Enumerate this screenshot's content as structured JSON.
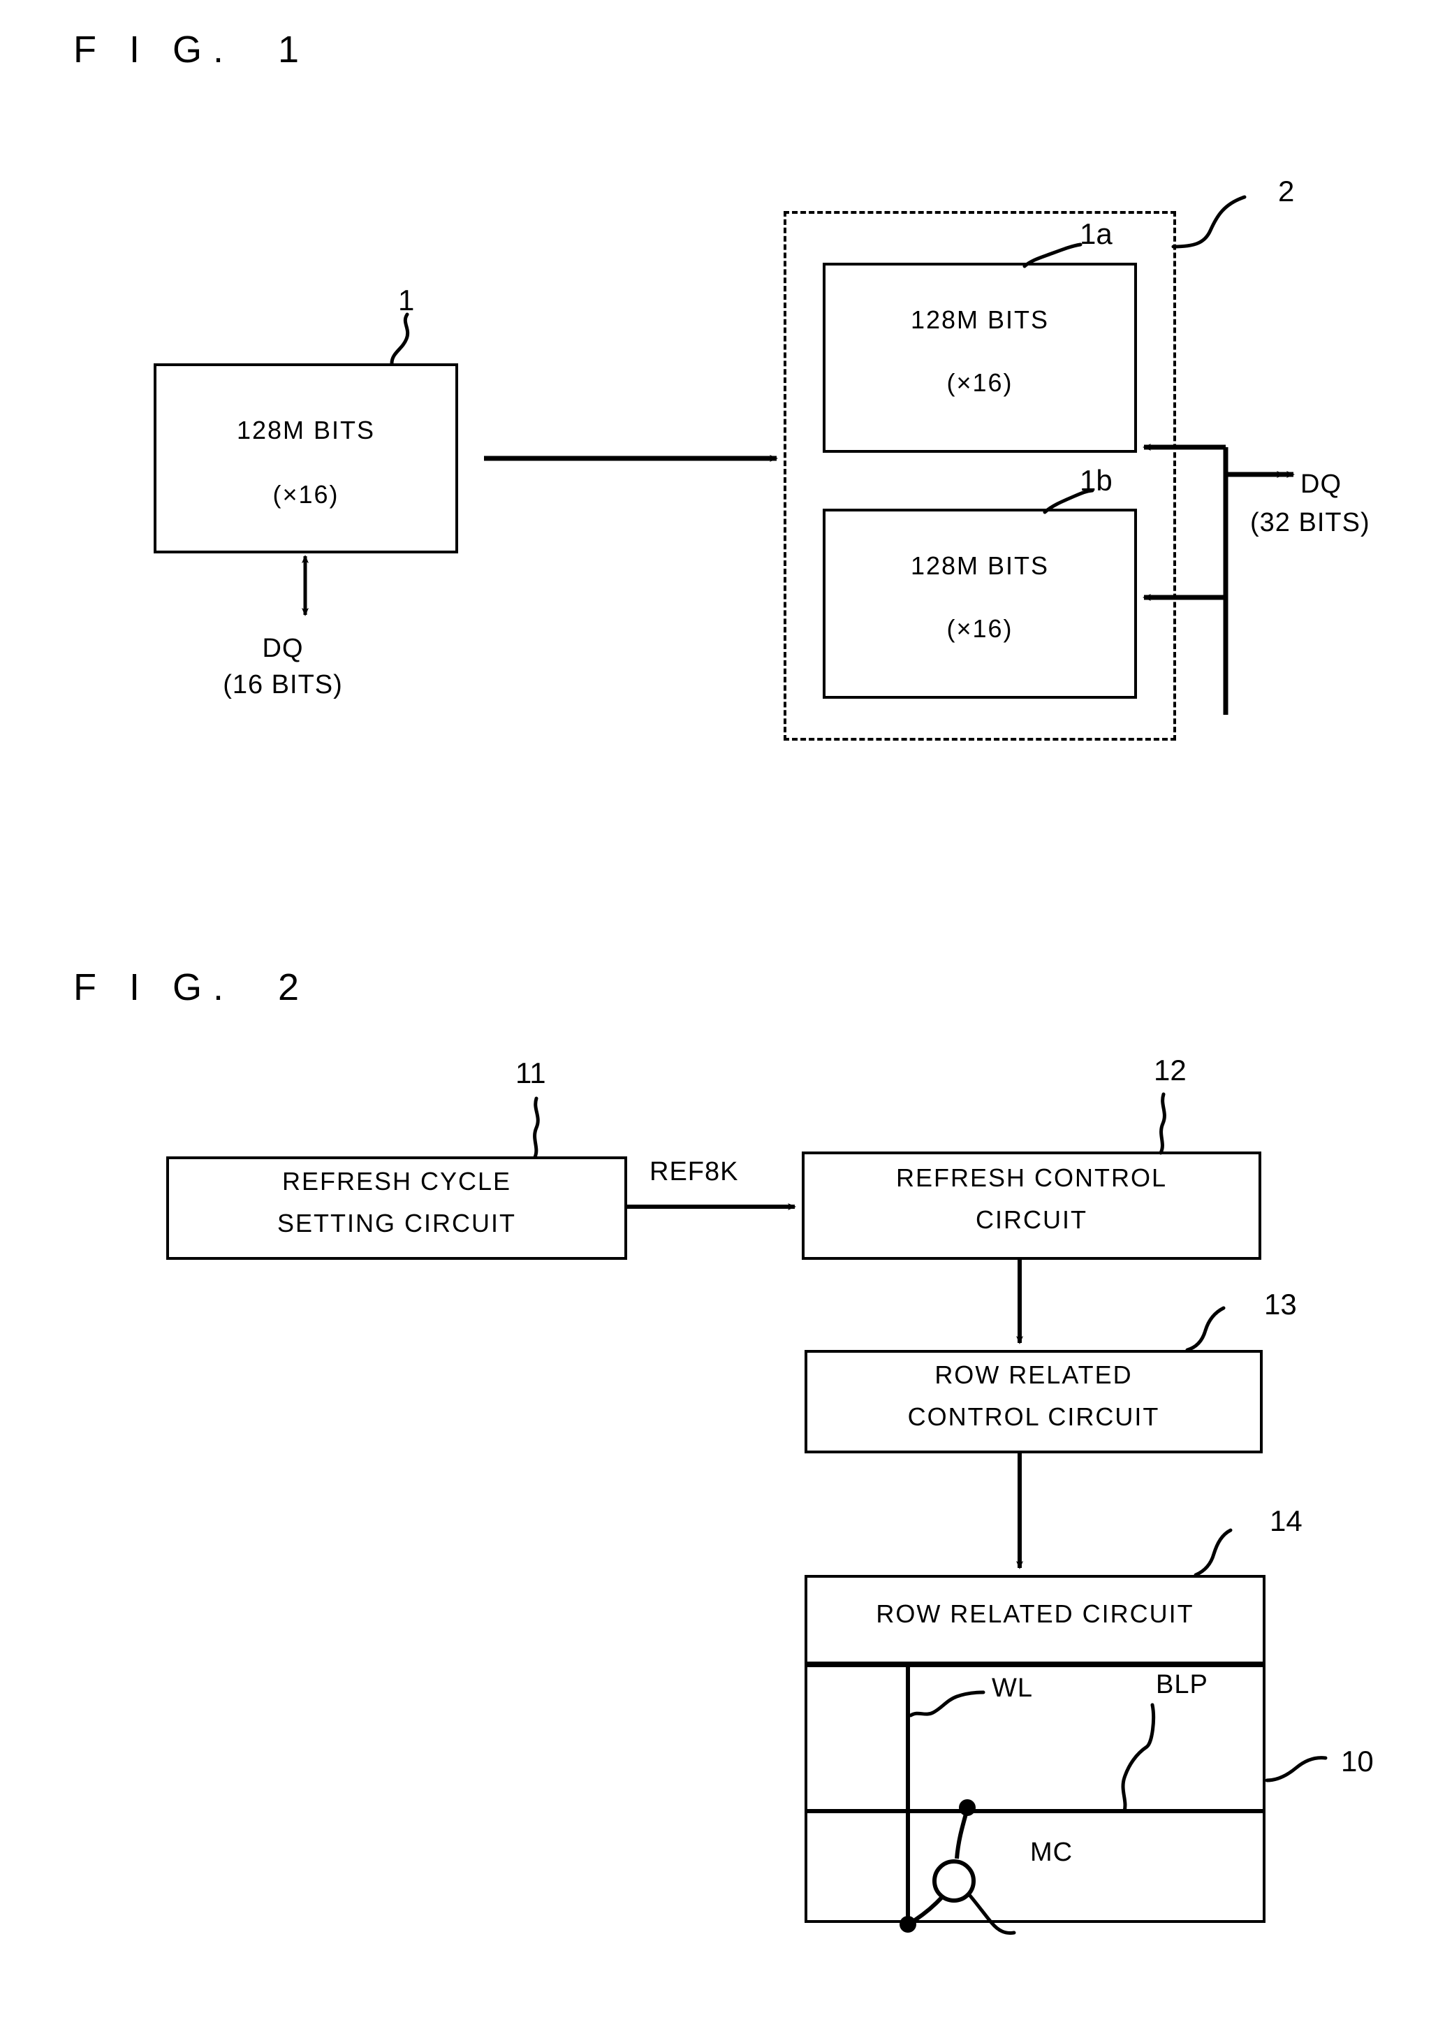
{
  "document": {
    "type": "patent-drawing-sheet",
    "figures": [
      "fig1",
      "fig2"
    ]
  },
  "fig1": {
    "title": "F I G.  1",
    "single_chip": {
      "ref": "1",
      "line1": "128M BITS",
      "line2": "(×16)"
    },
    "single_chip_io": {
      "signal": "DQ",
      "width": "(16 BITS)"
    },
    "module": {
      "ref": "2"
    },
    "chip_a": {
      "ref": "1a",
      "line1": "128M BITS",
      "line2": "(×16)"
    },
    "chip_b": {
      "ref": "1b",
      "line1": "128M BITS",
      "line2": "(×16)"
    },
    "module_io": {
      "signal": "DQ",
      "width": "(32 BITS)"
    }
  },
  "fig2": {
    "title": "F I G.  2",
    "blocks": [
      {
        "ref": "11",
        "line1": "REFRESH CYCLE",
        "line2": "SETTING CIRCUIT"
      },
      {
        "ref": "12",
        "line1": "REFRESH CONTROL",
        "line2": "CIRCUIT"
      },
      {
        "ref": "13",
        "line1": "ROW RELATED",
        "line2": "CONTROL CIRCUIT"
      },
      {
        "ref": "14",
        "line1": "ROW RELATED CIRCUIT",
        "line2": ""
      }
    ],
    "signal_ref8k": "REF8K",
    "array": {
      "ref": "10",
      "word_line": "WL",
      "bit_line_pair": "BLP",
      "memory_cell": "MC"
    }
  },
  "colors": {
    "ink": "#000000",
    "paper": "#ffffff"
  }
}
